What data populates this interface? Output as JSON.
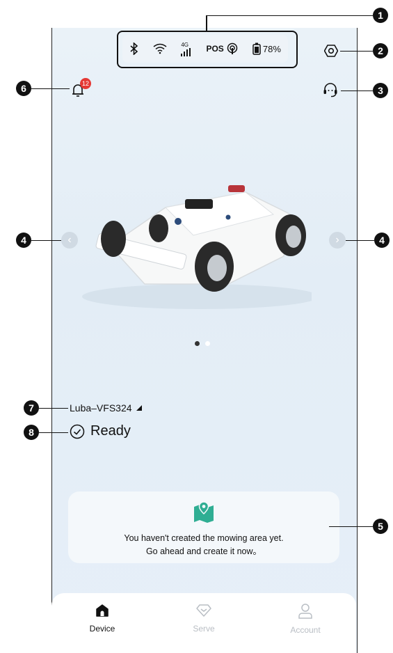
{
  "status_bar": {
    "network": "4G",
    "pos_label": "POS",
    "battery": "78%"
  },
  "notifications": {
    "badge_count": "12"
  },
  "device": {
    "name": "Luba–VFS324",
    "status": "Ready"
  },
  "carousel": {
    "page_count": 2,
    "active_index": 0
  },
  "mowing_card": {
    "line1": "You haven't created the mowing area yet.",
    "line2": "Go ahead and create it now。"
  },
  "tabs": [
    {
      "label": "Device",
      "active": true
    },
    {
      "label": "Serve",
      "active": false
    },
    {
      "label": "Account",
      "active": false
    }
  ],
  "callouts": [
    "1",
    "2",
    "3",
    "4",
    "4",
    "5",
    "6",
    "7",
    "8"
  ],
  "colors": {
    "accent": "#2fae93",
    "badge": "#e53935",
    "active_tab": "#111111",
    "inactive_tab": "#b9bec4"
  }
}
